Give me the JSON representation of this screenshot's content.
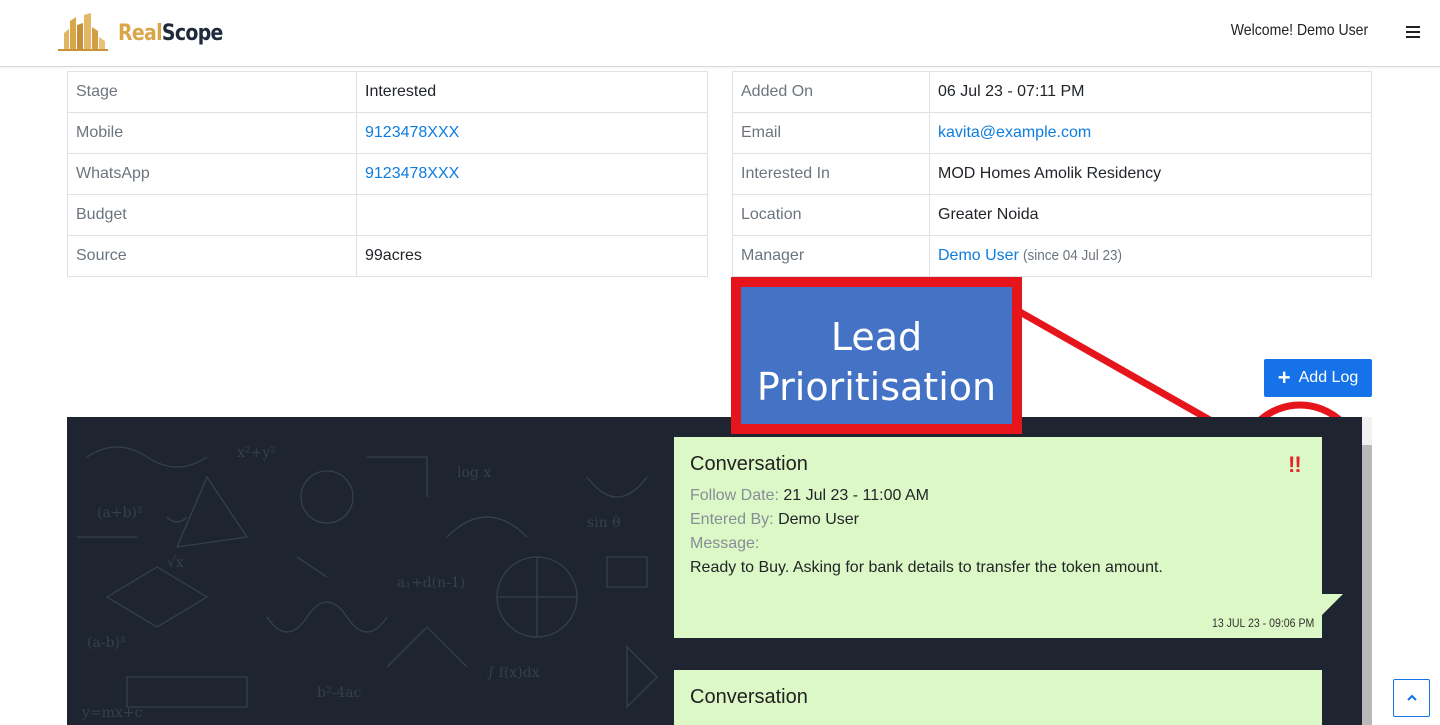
{
  "brand": {
    "name_part1": "Real",
    "name_part2": "Scope"
  },
  "header": {
    "welcome": "Welcome! Demo User"
  },
  "lead_left": [
    {
      "label": "Stage",
      "value": "Interested",
      "link": false
    },
    {
      "label": "Mobile",
      "value": "9123478XXX",
      "link": true
    },
    {
      "label": "WhatsApp",
      "value": "9123478XXX",
      "link": true
    },
    {
      "label": "Budget",
      "value": "",
      "link": false
    },
    {
      "label": "Source",
      "value": "99acres",
      "link": false
    }
  ],
  "lead_right": [
    {
      "label": "Added On",
      "value": "06 Jul 23 - 07:11 PM",
      "link": false
    },
    {
      "label": "Email",
      "value": "kavita@example.com",
      "link": true
    },
    {
      "label": "Interested In",
      "value": "MOD Homes Amolik Residency",
      "link": false
    },
    {
      "label": "Location",
      "value": "Greater Noida",
      "link": false
    },
    {
      "label": "Manager",
      "value": "Demo User",
      "link": true,
      "suffix": "(since 04 Jul 23)"
    }
  ],
  "annotation": {
    "line1": "Lead",
    "line2": "Prioritisation"
  },
  "actions": {
    "add_log": "Add Log"
  },
  "logs": [
    {
      "title": "Conversation",
      "follow_date_label": "Follow Date:",
      "follow_date": "21 Jul 23 - 11:00 AM",
      "entered_by_label": "Entered By:",
      "entered_by": "Demo User",
      "message_label": "Message:",
      "message": "Ready to Buy. Asking for bank details to transfer the token amount.",
      "timestamp": "13 JUL 23 - 09:06 PM",
      "priority": "!!"
    },
    {
      "title": "Conversation"
    }
  ],
  "colors": {
    "accent": "#1572e8",
    "bubble": "#dcf8c6",
    "annotation_red": "#e6141b",
    "annotation_blue": "#4472c4",
    "chat_bg": "#1e2530"
  },
  "icons": {
    "menu": "hamburger-icon",
    "add": "plus-icon",
    "scroll_top": "chevron-up-icon"
  }
}
